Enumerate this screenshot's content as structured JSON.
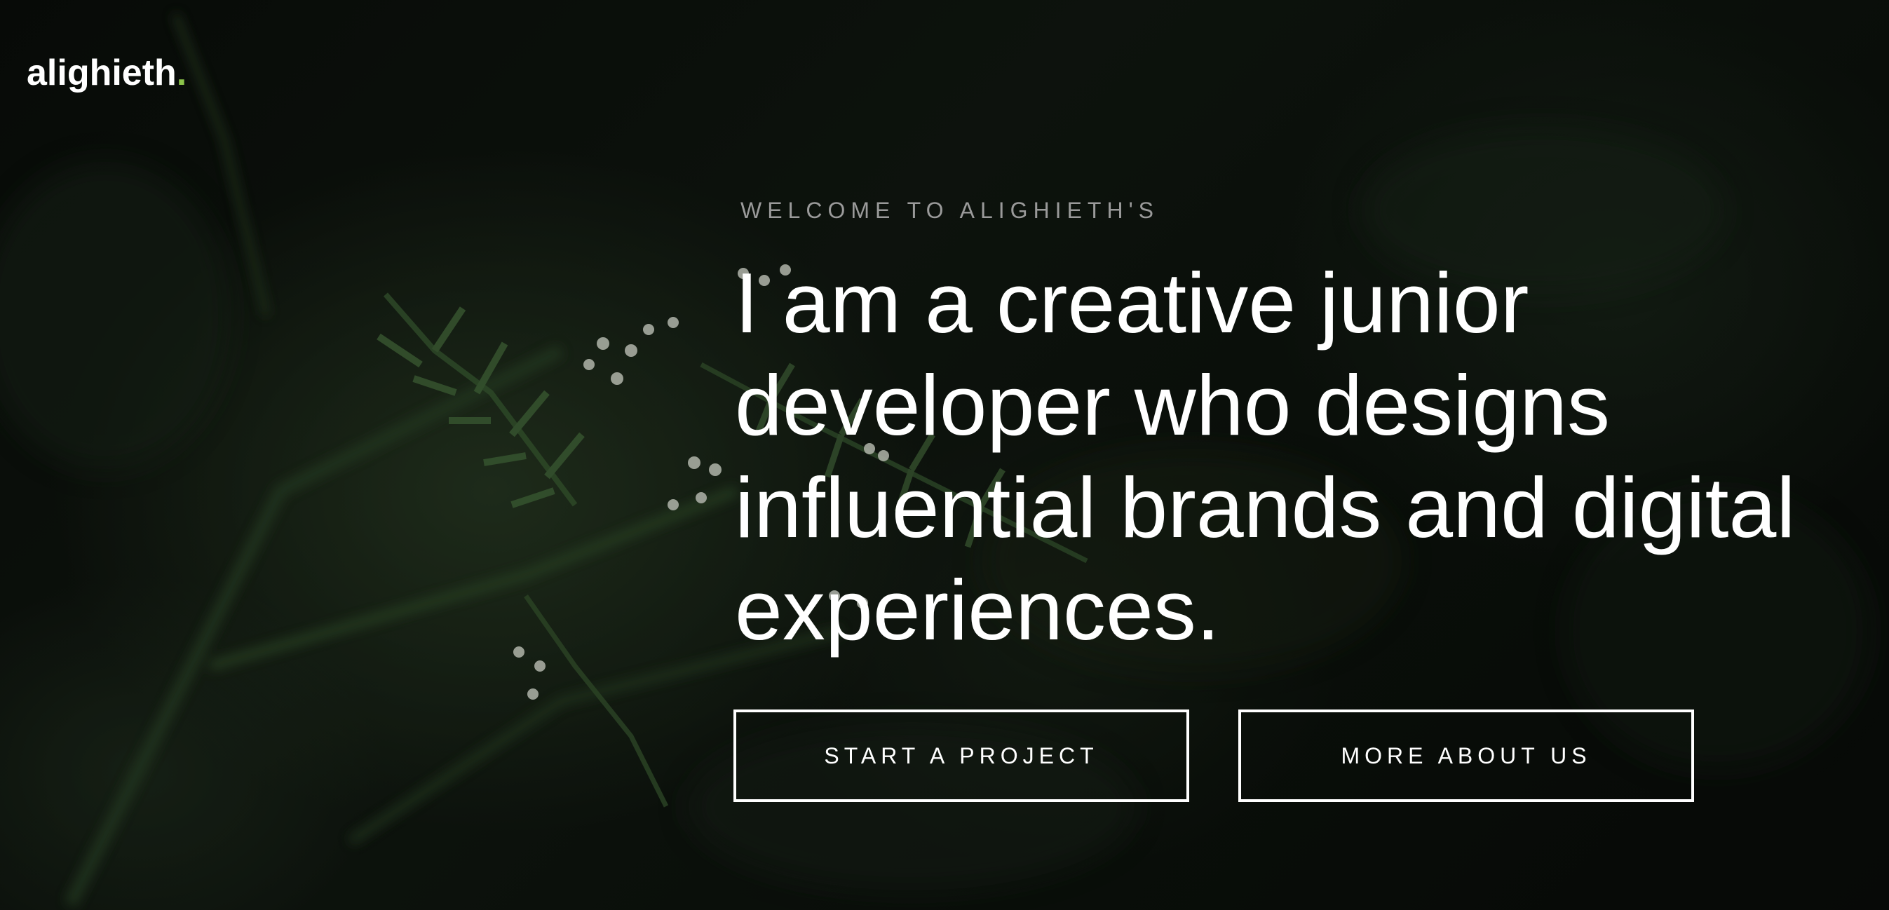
{
  "brand": {
    "name": "alighieth",
    "dot": ".",
    "accent_color": "#8bc34a"
  },
  "hero": {
    "eyebrow": "WELCOME TO ALIGHIETH'S",
    "headline": "I am a creative junior developer who designs influential brands and digital experiences.",
    "background_description_icon": "fern-foliage-photo"
  },
  "actions": {
    "primary_label": "START A PROJECT",
    "secondary_label": "MORE ABOUT US"
  }
}
